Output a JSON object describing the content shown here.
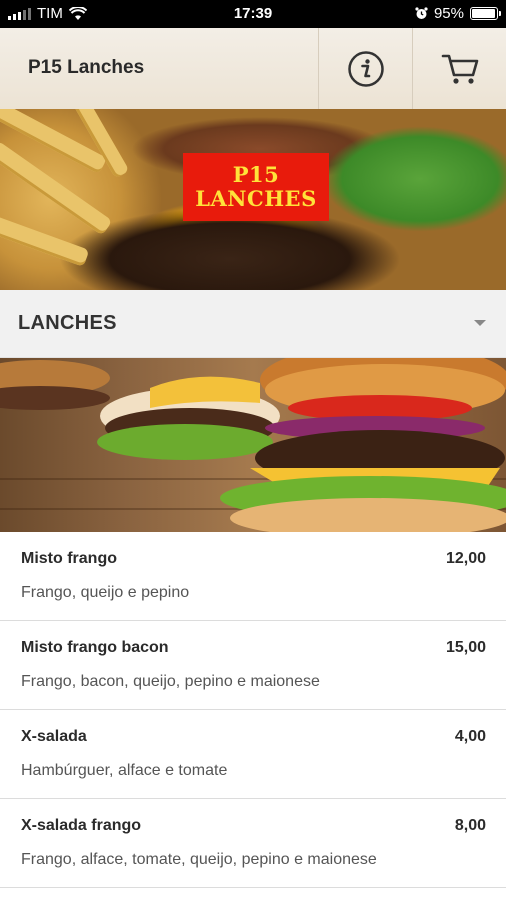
{
  "status_bar": {
    "carrier": "TIM",
    "time": "17:39",
    "battery": "95%"
  },
  "header": {
    "title": "P15 Lanches",
    "icons": [
      "info-icon",
      "cart-icon"
    ]
  },
  "banner": {
    "logo_line1": "P15",
    "logo_line2": "LANCHES",
    "logo_color": "#e81b0c",
    "logo_text_color": "#ffe33a"
  },
  "category": {
    "selected": "LANCHES"
  },
  "menu_items": [
    {
      "name": "Misto frango",
      "price": "12,00",
      "description": "Frango, queijo e pepino"
    },
    {
      "name": "Misto frango bacon",
      "price": "15,00",
      "description": "Frango, bacon, queijo, pepino e maionese"
    },
    {
      "name": "X-salada",
      "price": "4,00",
      "description": "Hambúrguer, alface e tomate"
    },
    {
      "name": "X-salada frango",
      "price": "8,00",
      "description": "Frango, alface, tomate, queijo, pepino e maionese"
    }
  ]
}
